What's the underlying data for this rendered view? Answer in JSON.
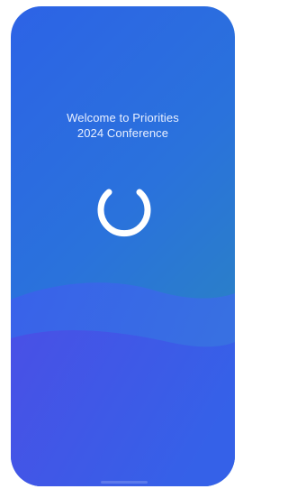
{
  "splash": {
    "title_line1": "Welcome to Priorities",
    "title_line2": "2024 Conference",
    "loading_icon": "loading-spinner-icon"
  },
  "colors": {
    "gradient_top_left": "#2d63e6",
    "gradient_top_right": "#2b8ab8",
    "wave_light": "#3b6bee",
    "wave_bottom": "#3a55e2",
    "text": "#e9f0ff",
    "spinner": "#ffffff"
  }
}
